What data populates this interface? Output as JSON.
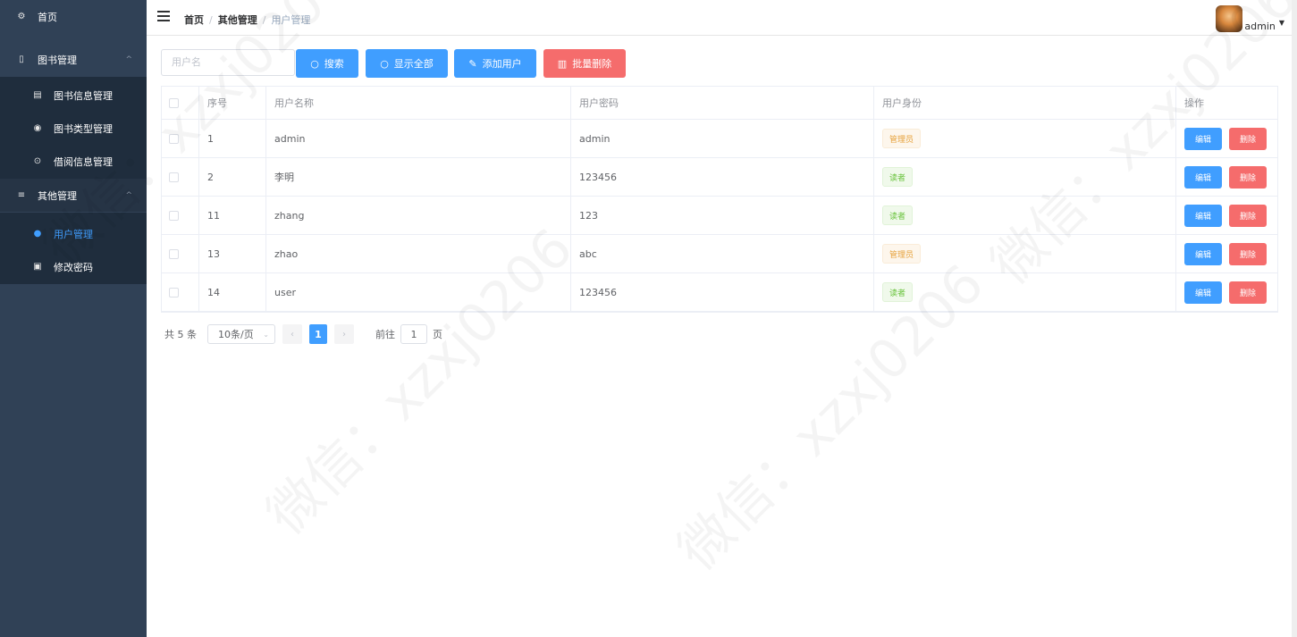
{
  "sidebar": {
    "items": [
      {
        "label": "首页",
        "icon": "dashboard-icon"
      },
      {
        "label": "图书管理",
        "icon": "book-icon"
      },
      {
        "label": "图书信息管理",
        "icon": "document-icon"
      },
      {
        "label": "图书类型管理",
        "icon": "circle-icon"
      },
      {
        "label": "借阅信息管理",
        "icon": "borrow-icon"
      },
      {
        "label": "其他管理",
        "icon": "list-icon"
      },
      {
        "label": "用户管理",
        "icon": "user-icon"
      },
      {
        "label": "修改密码",
        "icon": "lock-icon"
      }
    ]
  },
  "header": {
    "breadcrumb": [
      "首页",
      "其他管理",
      "用户管理"
    ],
    "username": "admin"
  },
  "toolbar": {
    "search_placeholder": "用户名",
    "search_label": "搜索",
    "show_all_label": "显示全部",
    "add_label": "添加用户",
    "batch_delete_label": "批量删除"
  },
  "table": {
    "columns": [
      "序号",
      "用户名称",
      "用户密码",
      "用户身份",
      "操作"
    ],
    "rows": [
      {
        "id": "1",
        "name": "admin",
        "password": "admin",
        "role": "管理员"
      },
      {
        "id": "2",
        "name": "李明",
        "password": "123456",
        "role": "读者"
      },
      {
        "id": "11",
        "name": "zhang",
        "password": "123",
        "role": "读者"
      },
      {
        "id": "13",
        "name": "zhao",
        "password": "abc",
        "role": "管理员"
      },
      {
        "id": "14",
        "name": "user",
        "password": "123456",
        "role": "读者"
      }
    ],
    "edit_label": "编辑",
    "delete_label": "删除"
  },
  "pagination": {
    "total": "共 5 条",
    "page_size": "10条/页",
    "current_page": "1",
    "goto_prefix": "前往",
    "goto_value": "1",
    "goto_suffix": "页"
  },
  "watermark": "微信：xzxj0206",
  "colors": {
    "primary": "#409eff",
    "danger": "#f56c6c",
    "sidebar_bg": "#304156"
  }
}
